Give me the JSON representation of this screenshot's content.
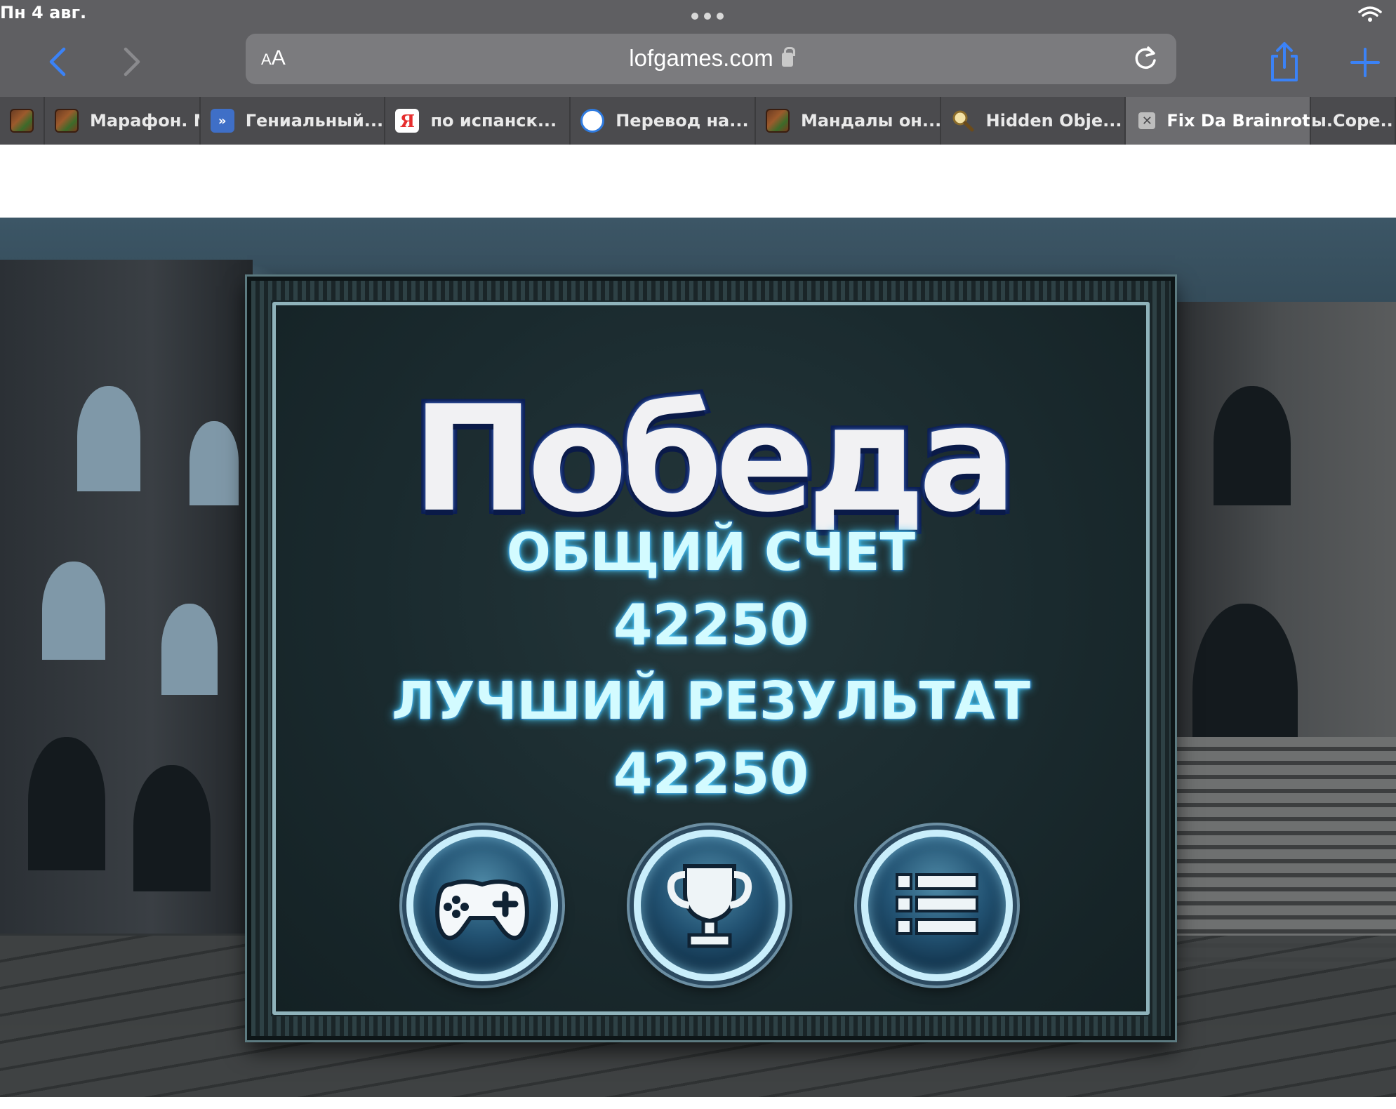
{
  "status_bar": {
    "time": "Пн 4 авг."
  },
  "browser": {
    "aa_label_small": "A",
    "aa_label_large": "A",
    "url": "lofgames.com",
    "tabs": [
      {
        "label": "",
        "icon": "mosaic-favicon"
      },
      {
        "label": "Марафон. М",
        "icon": "mosaic-favicon"
      },
      {
        "label": "Гениальный...",
        "icon": "blue-game-favicon"
      },
      {
        "label": "по испанск...",
        "icon": "yandex-favicon"
      },
      {
        "label": "Перевод на...",
        "icon": "translate-favicon"
      },
      {
        "label": "Мандалы он...",
        "icon": "mosaic-favicon"
      },
      {
        "label": "Hidden Obje...",
        "icon": "magnifier-favicon"
      },
      {
        "label": "Fix Da Brainrot",
        "icon": "close-icon",
        "active": true
      },
      {
        "label": "ы.Cope...",
        "icon": ""
      }
    ]
  },
  "game": {
    "title": "Победа",
    "total_label": "ОБЩИЙ СЧЕТ",
    "total_score": "42250",
    "best_label": "ЛУЧШИЙ РЕЗУЛЬТАТ",
    "best_score": "42250",
    "buttons": [
      {
        "icon": "gamepad-icon"
      },
      {
        "icon": "trophy-icon"
      },
      {
        "icon": "menu-list-icon"
      }
    ]
  },
  "colors": {
    "chrome": "#5f5f62",
    "tabbar": "#4b4b4e",
    "accent_blue": "#3b82f6",
    "score_glow": "#42c7f5"
  }
}
